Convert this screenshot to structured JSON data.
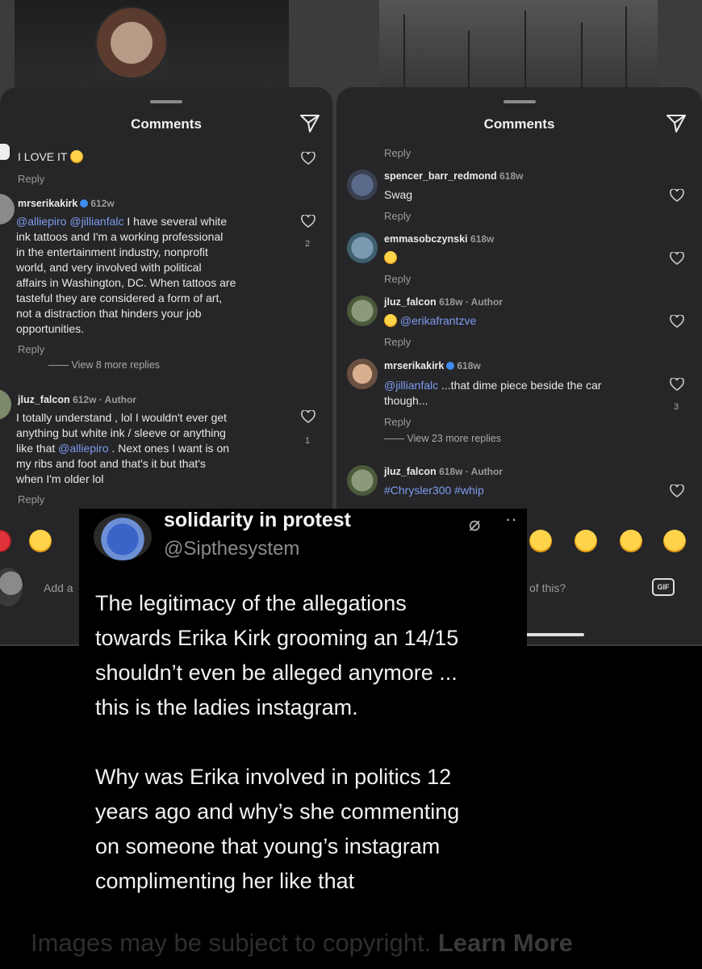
{
  "left_panel": {
    "title": "Comments",
    "comments": [
      {
        "text": "I LOVE IT",
        "reply": "Reply"
      },
      {
        "user": "mrserikakirk",
        "time": "612w",
        "mention1": "@alliepiro",
        "mention2": "@jillianfalc",
        "lines": [
          "I have several white",
          "ink tattoos and I'm a working professional",
          "in the entertainment industry, nonprofit",
          "world, and very involved with political",
          "affairs in Washington, DC. When tattoos are",
          "tasteful they are considered a form of art,",
          "not a distraction that hinders your job",
          "opportunities."
        ],
        "reply": "Reply",
        "view_more": "View 8 more replies",
        "likes": "2"
      },
      {
        "user": "jluz_falcon",
        "time": "612w · Author",
        "lines": [
          "I totally understand , lol I wouldn't ever get",
          "anything but white ink / sleeve or anything",
          "like that",
          "on",
          "my ribs and foot and that's it but that's",
          "when I'm older lol"
        ],
        "mention": "@alliepiro",
        "after_mention": ". Next ones I want is",
        "reply": "Reply",
        "likes": "1"
      }
    ],
    "add_comment": "Add a"
  },
  "right_panel": {
    "title": "Comments",
    "top_reply": "Reply",
    "comments": [
      {
        "user": "spencer_barr_redmond",
        "time": "618w",
        "text": "Swag",
        "reply": "Reply"
      },
      {
        "user": "emmasobczynski",
        "time": "618w",
        "reply": "Reply"
      },
      {
        "user": "jluz_falcon",
        "time": "618w · Author",
        "mention": "@erikafrantzve",
        "reply": "Reply"
      },
      {
        "user": "mrserikakirk",
        "time": "618w",
        "mention": "@jillianfalc",
        "line1": "...that dime piece beside the car",
        "line2": "though...",
        "reply": "Reply",
        "view_more": "View 23 more replies",
        "likes": "3"
      },
      {
        "user": "jluz_falcon",
        "time": "618w · Author",
        "tags": "#Chrysler300 #whip"
      }
    ],
    "add_comment_tail": "of this?",
    "gif_label": "GIF"
  },
  "tweet": {
    "name": "solidarity in protest",
    "handle": "@Sipthesystem",
    "paragraph1": [
      "The legitimacy of the allegations",
      "towards Erika Kirk grooming an 14/15",
      "shouldn’t even be alleged anymore ...",
      "this is the ladies instagram."
    ],
    "paragraph2": [
      "Why was Erika involved in politics 12",
      "years ago and why’s she commenting",
      "on someone that young’s instagram",
      "complimenting her like that"
    ]
  },
  "footer": {
    "text": "Images may be subject to copyright.",
    "link": "Learn More"
  },
  "colors": {
    "panel": "#262628",
    "mention": "#7d9cf0",
    "background": "#3c3c3e"
  }
}
